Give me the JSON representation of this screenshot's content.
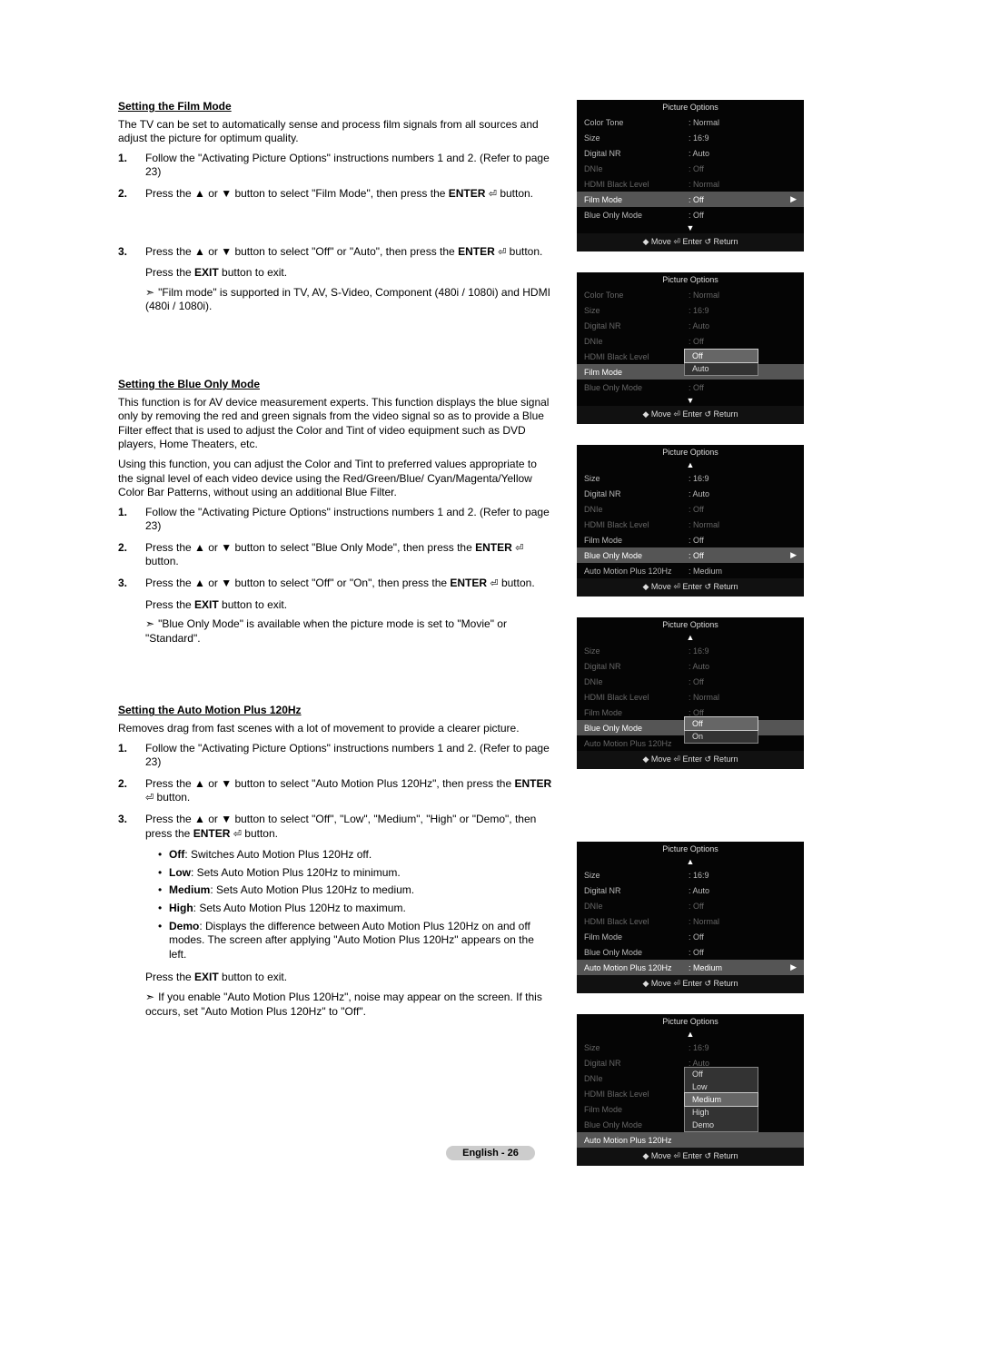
{
  "sections": {
    "film": {
      "title": "Setting the Film Mode",
      "intro": "The TV can be set to automatically sense and process film signals from all sources and adjust the picture for optimum quality.",
      "step1": "Follow the \"Activating Picture Options\" instructions numbers 1 and 2. (Refer to page 23)",
      "step2_a": "Press the ▲ or ▼ button to select \"Film Mode\", then press the ",
      "step2_b": "ENTER",
      "step2_c": " button.",
      "step3_a": "Press the ▲ or ▼ button to select \"Off\" or \"Auto\", then press the ",
      "step3_b": "ENTER",
      "step3_c": " button.",
      "exit_a": "Press the ",
      "exit_b": "EXIT",
      "exit_c": " button to exit.",
      "note_a": "\"Film mode\" is supported in TV, AV, S-Video, Component (480i / 1080i) and HDMI (480i / 1080i)."
    },
    "blue": {
      "title": "Setting the Blue Only Mode",
      "para1": "This function is for AV device measurement experts. This function displays the blue signal only by removing the red and green signals from the video signal so as to provide a Blue Filter effect that is used to adjust the Color and Tint of video equipment such as DVD players, Home Theaters, etc.",
      "para2": "Using this function, you can adjust the Color and Tint to preferred values appropriate to the signal level of each video device using the Red/Green/Blue/ Cyan/Magenta/Yellow Color Bar Patterns, without using an additional Blue Filter.",
      "step1": "Follow the \"Activating Picture Options\" instructions numbers 1 and 2. (Refer to page 23)",
      "step2_a": "Press the ▲ or ▼ button to select \"Blue Only Mode\", then press the ",
      "step2_b": "ENTER",
      "step2_c": " button.",
      "step3_a": "Press the ▲ or ▼ button to select \"Off\" or \"On\", then press the ",
      "step3_b": "ENTER",
      "step3_c": " button.",
      "exit_a": "Press the ",
      "exit_b": "EXIT",
      "exit_c": " button to exit.",
      "note_a": "\"Blue Only Mode\" is available when the picture mode is set to \"Movie\" or \"Standard\"."
    },
    "amp": {
      "title": "Setting the Auto Motion Plus 120Hz",
      "intro": "Removes drag from fast scenes with a lot of movement to provide a clearer picture.",
      "step1": "Follow the \"Activating Picture Options\" instructions numbers 1 and 2. (Refer to page 23)",
      "step2_a": "Press the ▲ or ▼ button to select \"Auto Motion Plus 120Hz\", then press the ",
      "step2_b": "ENTER",
      "step2_c": " button.",
      "step3_a": "Press the ▲ or ▼ button to select \"Off\", \"Low\", \"Medium\", \"High\" or \"Demo\", then press the ",
      "step3_b": "ENTER",
      "step3_c": " button.",
      "bul_off_b": "Off",
      "bul_off_t": ": Switches Auto Motion Plus 120Hz off.",
      "bul_low_b": "Low",
      "bul_low_t": ": Sets Auto Motion Plus 120Hz to minimum.",
      "bul_med_b": "Medium",
      "bul_med_t": ": Sets Auto Motion Plus 120Hz to medium.",
      "bul_high_b": "High",
      "bul_high_t": ": Sets Auto Motion Plus 120Hz to maximum.",
      "bul_demo_b": "Demo",
      "bul_demo_t": ": Displays the difference between Auto Motion Plus 120Hz on and off modes. The screen after applying \"Auto Motion Plus 120Hz\" appears on the left.",
      "exit_a": "Press the ",
      "exit_b": "EXIT",
      "exit_c": " button to exit.",
      "note_a": "If you enable \"Auto Motion Plus 120Hz\", noise may appear on the screen. If this occurs, set \"Auto Motion Plus 120Hz\" to \"Off\"."
    }
  },
  "osd": {
    "title": "Picture Options",
    "labels": {
      "color_tone": "Color Tone",
      "size": "Size",
      "digital_nr": "Digital NR",
      "dnie": "DNIe",
      "hdmi_black": "HDMI Black Level",
      "film_mode": "Film Mode",
      "blue_only": "Blue Only Mode",
      "amp": "Auto Motion Plus 120Hz"
    },
    "values": {
      "normal": "Normal",
      "v169": "16:9",
      "auto": "Auto",
      "off": "Off",
      "on": "On",
      "medium": "Medium",
      "low": "Low",
      "high": "High",
      "demo": "Demo"
    },
    "footer": "◆ Move    ⏎ Enter    ↺ Return"
  },
  "page_footer": "English - 26",
  "sym": {
    "enter": "⏎",
    "arrow": "➣",
    "dot": "•",
    "down": "▼",
    "up": "▲",
    "right": "▶"
  }
}
